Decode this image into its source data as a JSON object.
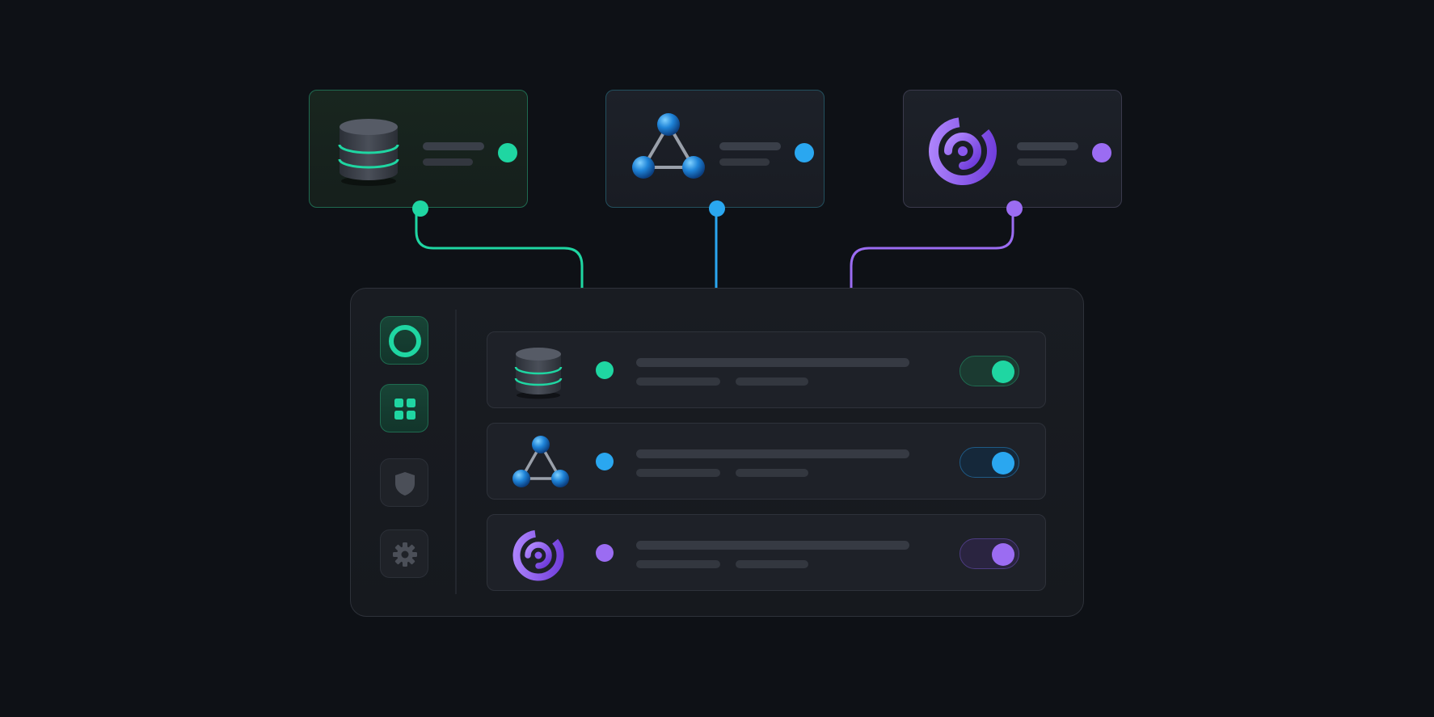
{
  "colors": {
    "background": "#0e1116",
    "green": "#1fd6a2",
    "blue": "#2aa7f0",
    "purple": "#9b6cf2"
  },
  "source_cards": [
    {
      "icon": "database-icon",
      "accent": "#1fd6a2"
    },
    {
      "icon": "network-triangle-icon",
      "accent": "#2aa7f0"
    },
    {
      "icon": "spiral-icon",
      "accent": "#9b6cf2"
    }
  ],
  "sidebar": {
    "items": [
      {
        "icon": "ring-icon",
        "active": true
      },
      {
        "icon": "grid-icon",
        "active": true
      },
      {
        "icon": "shield-icon",
        "active": false
      },
      {
        "icon": "gear-icon",
        "active": false
      }
    ]
  },
  "integrations": [
    {
      "icon": "database-icon",
      "accent": "#1fd6a2",
      "enabled": true
    },
    {
      "icon": "network-triangle-icon",
      "accent": "#2aa7f0",
      "enabled": true
    },
    {
      "icon": "spiral-icon",
      "accent": "#9b6cf2",
      "enabled": true
    }
  ]
}
